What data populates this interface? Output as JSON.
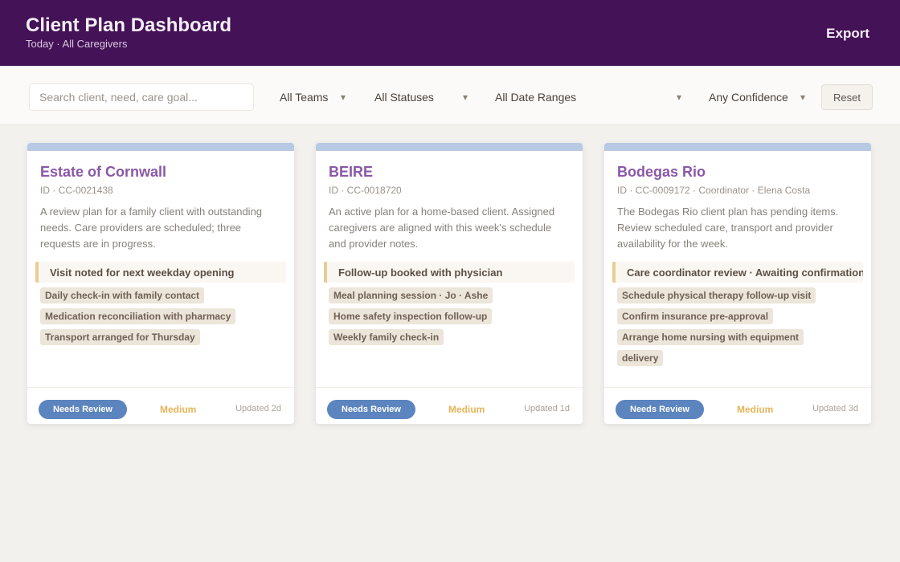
{
  "header": {
    "title": "Client Plan Dashboard",
    "subtitle": "Today · All Caregivers",
    "exit_label": "Export"
  },
  "filters": {
    "search_placeholder": "Search client, need, care goal...",
    "team": "All Teams",
    "status": "All Statuses",
    "window": "All Date Ranges",
    "confidence": "Any Confidence",
    "reset_label": "Reset"
  },
  "colors": {
    "header_bg": "#441257",
    "accent": "#5c84bf",
    "card_top_bar": "#b7c9e3",
    "note_border": "#e9cc93"
  },
  "cards": [
    {
      "name": "Estate of Cornwall",
      "meta": "ID · CC-0021438",
      "desc": "A review plan for a family client with outstanding needs. Care providers are scheduled; three requests are in progress.",
      "note": "Visit noted for next weekday opening",
      "tags": [
        "Daily check-in with family contact",
        "Medication reconciliation with pharmacy",
        "Transport arranged for Thursday"
      ],
      "status_label": "Needs Review",
      "priority": "Medium",
      "updated": "Updated 2d"
    },
    {
      "name": "BEIRE",
      "meta": "ID · CC-0018720",
      "desc": "An active plan for a home-based client. Assigned caregivers are aligned with this week's schedule and provider notes.",
      "note": "Follow-up booked with physician",
      "tags": [
        "Meal planning session · Jo · Ashe",
        "Home safety inspection follow-up",
        "Weekly family check-in"
      ],
      "status_label": "Needs Review",
      "priority": "Medium",
      "updated": "Updated 1d"
    },
    {
      "name": "Bodegas Rio",
      "meta": "ID · CC-0009172 · Coordinator · Elena Costa",
      "desc": "The Bodegas Rio client plan has pending items. Review scheduled care, transport and provider availability for the week.",
      "note": "Care coordinator review · Awaiting confirmation",
      "tags": [
        "Schedule physical therapy follow-up visit",
        "Confirm insurance pre-approval",
        "Arrange home nursing with equipment",
        "delivery"
      ],
      "status_label": "Needs Review",
      "priority": "Medium",
      "updated": "Updated 3d"
    }
  ]
}
